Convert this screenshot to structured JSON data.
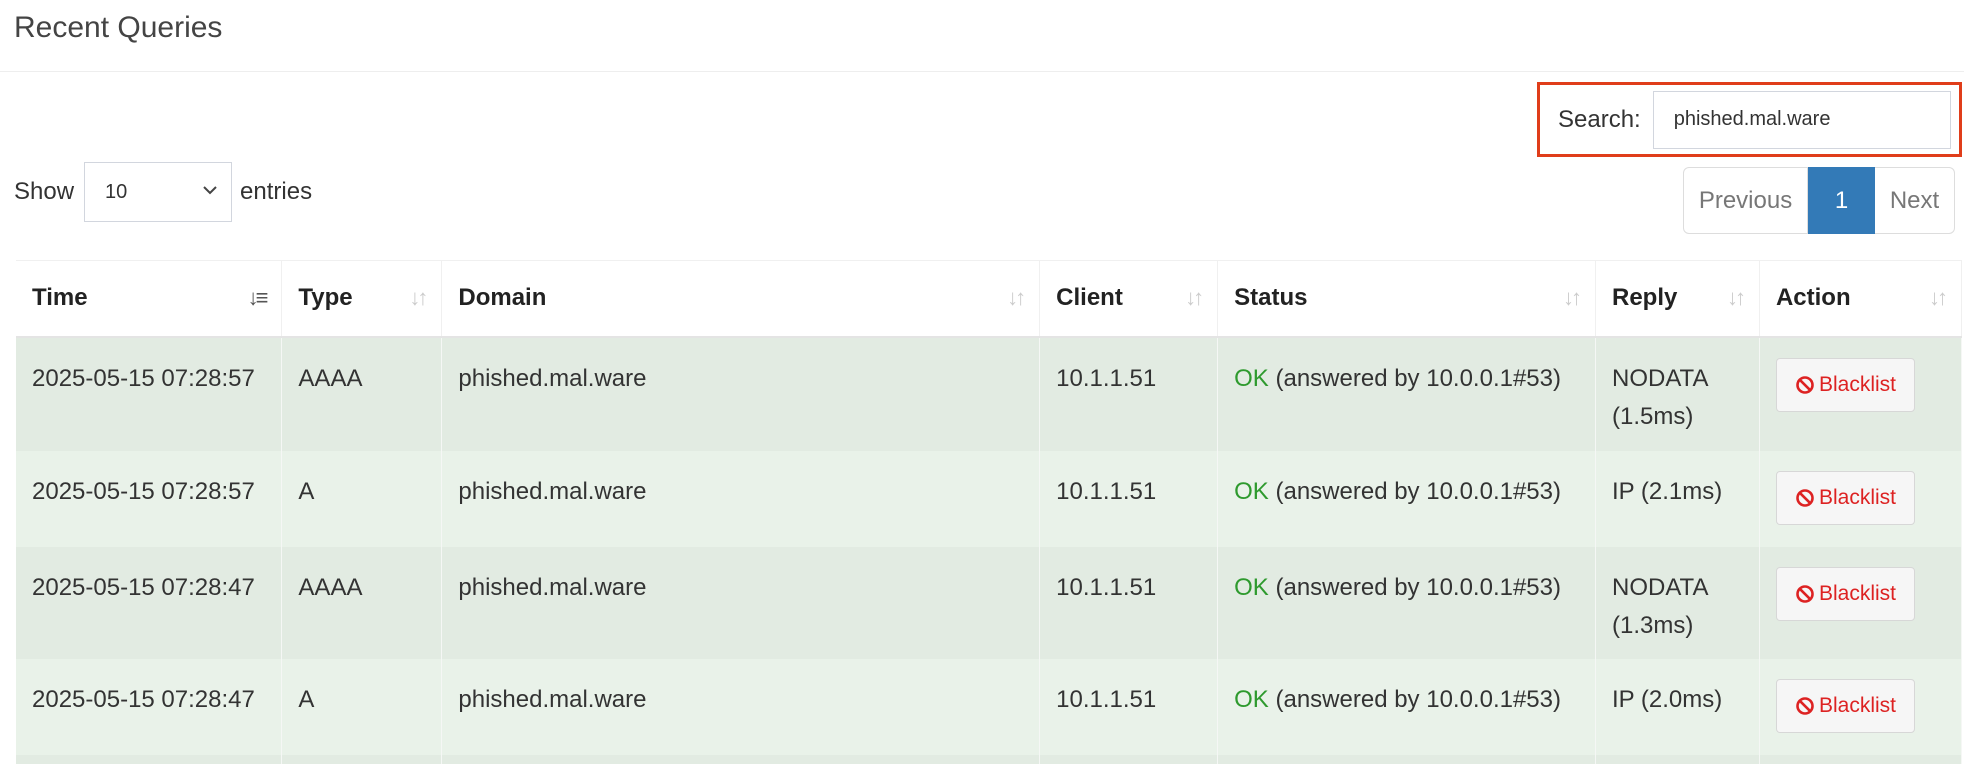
{
  "header": {
    "title": "Recent Queries"
  },
  "search": {
    "label": "Search:",
    "value": "phished.mal.ware"
  },
  "length": {
    "show_label": "Show",
    "selected": "10",
    "entries_label": "entries"
  },
  "pagination": {
    "previous": "Previous",
    "current": "1",
    "next": "Next"
  },
  "table": {
    "columns": [
      "Time",
      "Type",
      "Domain",
      "Client",
      "Status",
      "Reply",
      "Action"
    ],
    "rows": [
      {
        "time": "2025-05-15 07:28:57",
        "type": "AAAA",
        "domain": "phished.mal.ware",
        "client": "10.1.1.51",
        "status_ok": "OK",
        "status_rest": " (answered by 10.0.0.1#53)",
        "reply_line1": "NODATA",
        "reply_line2": "(1.5ms)",
        "action": "Blacklist"
      },
      {
        "time": "2025-05-15 07:28:57",
        "type": "A",
        "domain": "phished.mal.ware",
        "client": "10.1.1.51",
        "status_ok": "OK",
        "status_rest": " (answered by 10.0.0.1#53)",
        "reply_line1": "IP (2.1ms)",
        "reply_line2": "",
        "action": "Blacklist"
      },
      {
        "time": "2025-05-15 07:28:47",
        "type": "AAAA",
        "domain": "phished.mal.ware",
        "client": "10.1.1.51",
        "status_ok": "OK",
        "status_rest": " (answered by 10.0.0.1#53)",
        "reply_line1": "NODATA",
        "reply_line2": "(1.3ms)",
        "action": "Blacklist"
      },
      {
        "time": "2025-05-15 07:28:47",
        "type": "A",
        "domain": "phished.mal.ware",
        "client": "10.1.1.51",
        "status_ok": "OK",
        "status_rest": " (answered by 10.0.0.1#53)",
        "reply_line1": "IP (2.0ms)",
        "reply_line2": "",
        "action": "Blacklist"
      }
    ]
  },
  "colors": {
    "highlight_border": "#e03d1a",
    "ok": "#2e9a2e",
    "blacklist": "#dd2222",
    "pagination_active": "#337ab7",
    "row_even": "#e2ebe2",
    "row_odd": "#e9f2e9"
  },
  "icons": {
    "sort_time": "sort-desc-active-icon",
    "sort_other": "sort-both-icon",
    "select_chevron": "chevron-down-icon",
    "blacklist": "ban-icon"
  }
}
